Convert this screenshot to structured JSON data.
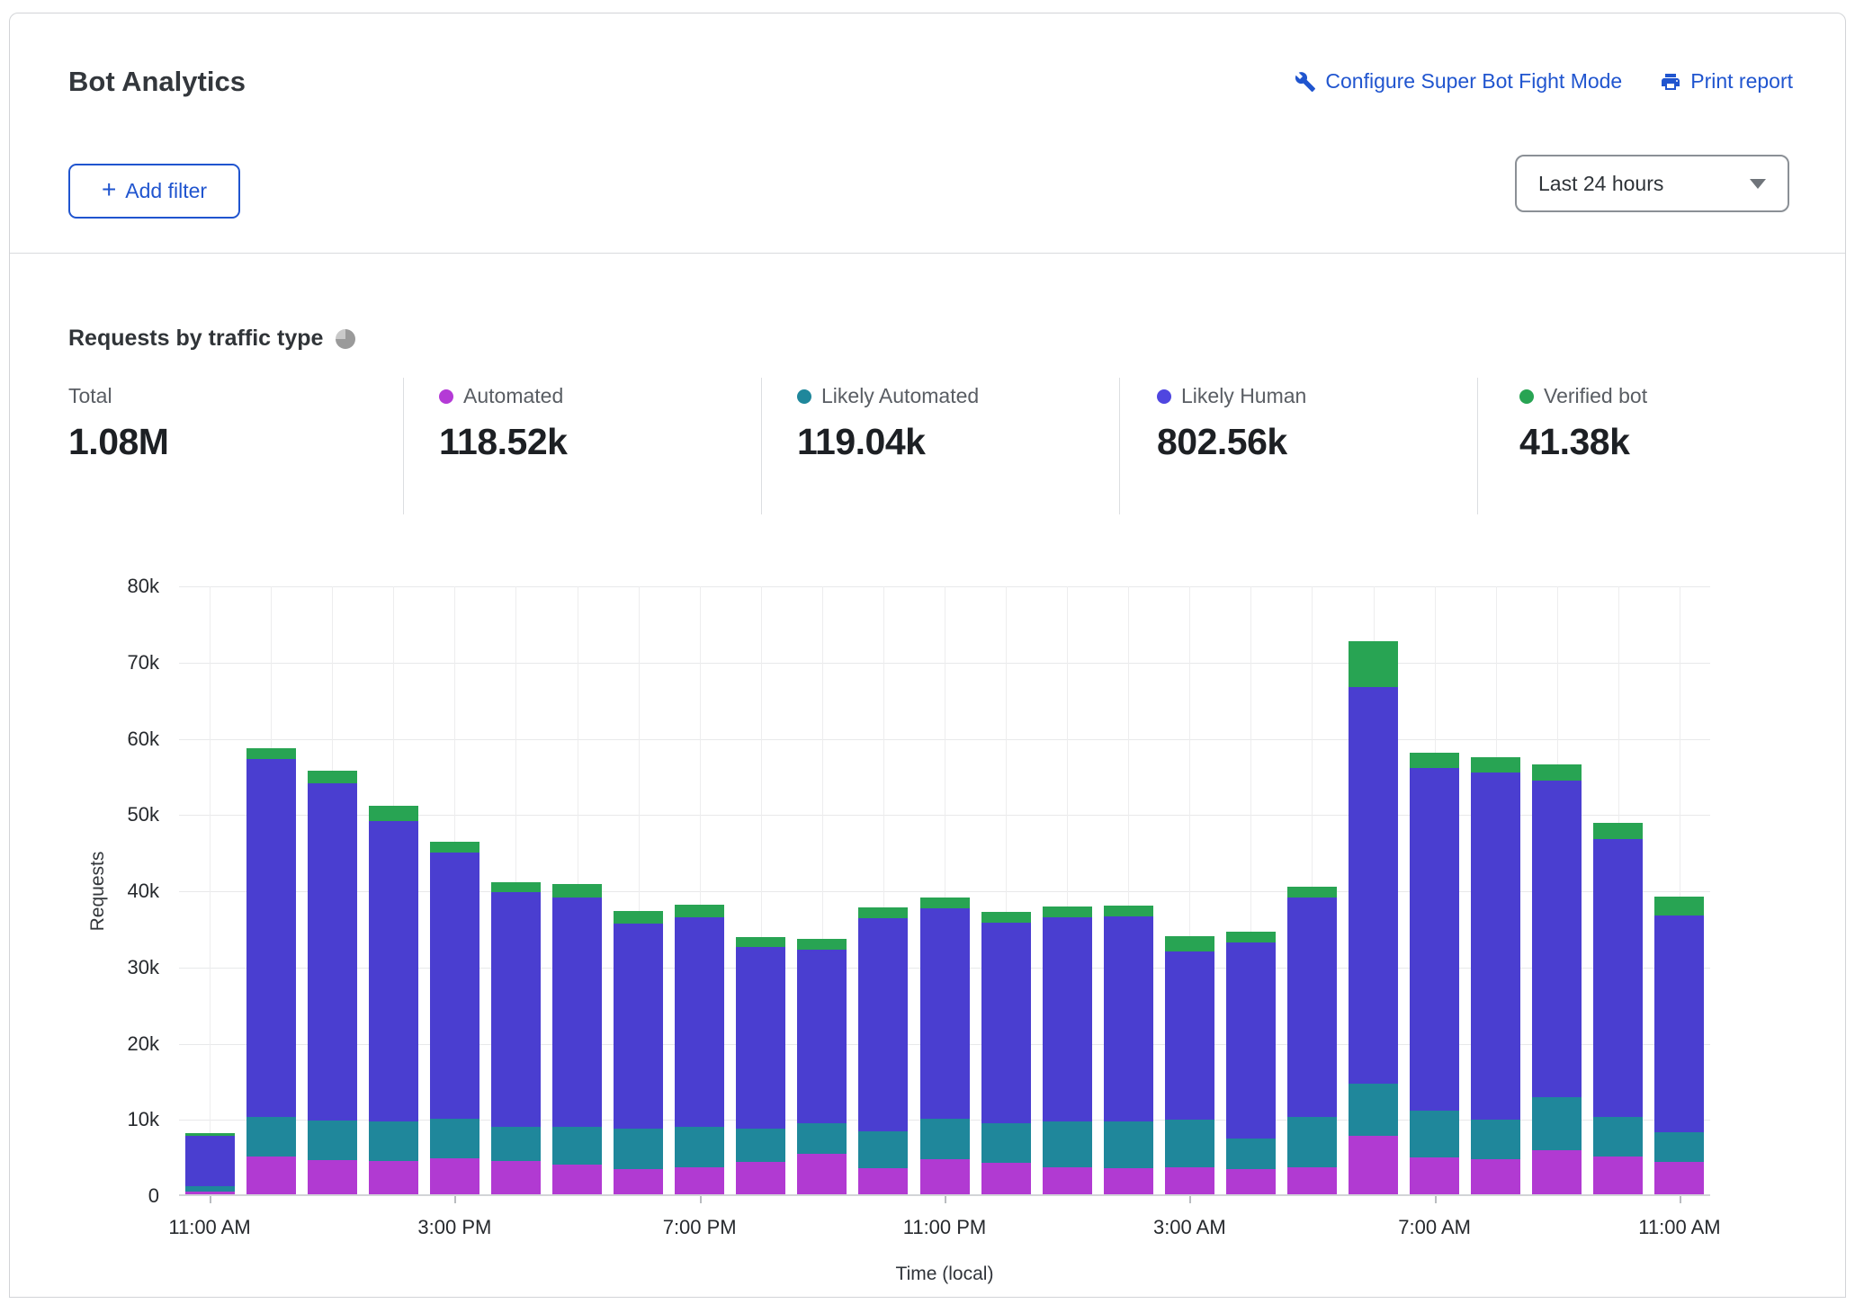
{
  "header": {
    "title": "Bot Analytics",
    "configure_link": "Configure Super Bot Fight Mode",
    "print_link": "Print report",
    "add_filter": {
      "icon": "+",
      "label": "Add filter"
    },
    "time_range": "Last 24 hours"
  },
  "section": {
    "title": "Requests by traffic type"
  },
  "stats": [
    {
      "label": "Total",
      "value": "1.08M",
      "color": null
    },
    {
      "label": "Automated",
      "value": "118.52k",
      "color": "#b43ad6"
    },
    {
      "label": "Likely Automated",
      "value": "119.04k",
      "color": "#1f879b"
    },
    {
      "label": "Likely Human",
      "value": "802.56k",
      "color": "#4f46e0"
    },
    {
      "label": "Verified bot",
      "value": "41.38k",
      "color": "#28a453"
    }
  ],
  "chart_data": {
    "type": "bar",
    "stacked": true,
    "title": "Requests by traffic type",
    "xlabel": "Time (local)",
    "ylabel": "Requests",
    "ylim": [
      0,
      80000
    ],
    "y_tick_labels": [
      "80k",
      "70k",
      "60k",
      "50k",
      "40k",
      "30k",
      "20k",
      "10k",
      "0"
    ],
    "x_tick_labels": [
      "11:00 AM",
      "3:00 PM",
      "7:00 PM",
      "11:00 PM",
      "3:00 AM",
      "7:00 AM",
      "11:00 AM"
    ],
    "x_tick_bar_indexes": [
      0,
      4,
      8,
      12,
      16,
      20,
      24
    ],
    "bars": 25,
    "bar_interval": "1 hour",
    "values_unit": "thousands of requests",
    "grid": true,
    "legend_position": "stats row above chart",
    "series": [
      {
        "name": "Automated",
        "color": "#b13ad2",
        "values": [
          0.4,
          4.9,
          4.5,
          4.4,
          4.7,
          4.4,
          3.9,
          3.3,
          3.6,
          4.2,
          5.3,
          3.4,
          4.6,
          4.1,
          3.5,
          3.4,
          3.5,
          3.3,
          3.5,
          7.7,
          4.8,
          4.6,
          5.8,
          5.0,
          4.2
        ]
      },
      {
        "name": "Likely Automated",
        "color": "#1f879b",
        "values": [
          0.7,
          5.2,
          5.2,
          5.2,
          5.2,
          4.4,
          5.0,
          5.3,
          5.3,
          4.4,
          4.0,
          4.9,
          5.3,
          5.2,
          6.1,
          6.2,
          6.3,
          4.0,
          6.6,
          6.8,
          6.2,
          5.2,
          6.9,
          5.1,
          4.0
        ]
      },
      {
        "name": "Likely Human",
        "color": "#4a3ed0",
        "values": [
          6.6,
          47.0,
          44.2,
          39.4,
          34.9,
          30.8,
          30.0,
          26.9,
          27.4,
          23.9,
          22.8,
          27.9,
          27.6,
          26.3,
          26.8,
          26.9,
          22.1,
          25.8,
          28.9,
          52.1,
          44.9,
          45.5,
          41.6,
          36.5,
          28.4
        ]
      },
      {
        "name": "Verified bot",
        "color": "#28a453",
        "values": [
          0.3,
          1.4,
          1.7,
          2.0,
          1.5,
          1.4,
          1.8,
          1.7,
          1.7,
          1.3,
          1.4,
          1.4,
          1.4,
          1.4,
          1.4,
          1.4,
          2.0,
          1.4,
          1.4,
          6.0,
          2.0,
          2.1,
          2.1,
          2.1,
          2.5
        ]
      }
    ]
  }
}
